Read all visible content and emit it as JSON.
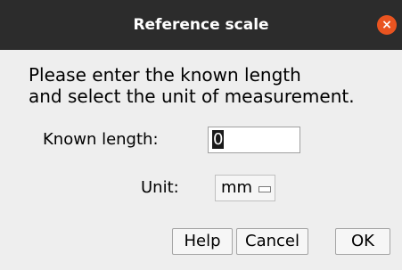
{
  "window": {
    "title": "Reference scale",
    "close_glyph": "×"
  },
  "message": {
    "line1": "Please enter the known length",
    "line2": "and select the unit of measurement."
  },
  "form": {
    "length_label": "Known length:",
    "length_value": "0",
    "unit_label": "Unit:",
    "unit_value": "mm"
  },
  "buttons": {
    "help": "Help",
    "cancel": "Cancel",
    "ok": "OK"
  },
  "colors": {
    "titlebar": "#2c2c2c",
    "close": "#e95420",
    "dialog_bg": "#eeeeee"
  }
}
